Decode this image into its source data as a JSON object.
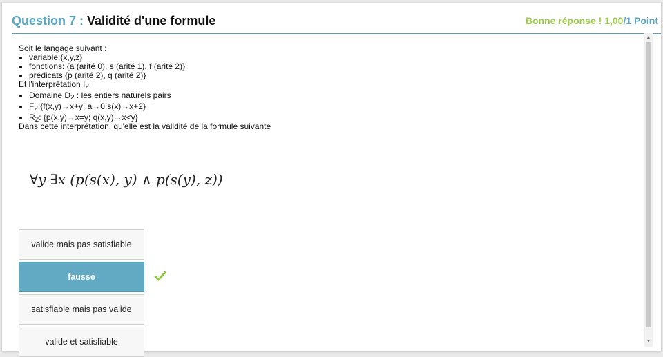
{
  "header": {
    "question_number": "Question 7 :",
    "question_title": "Validité d'une formule",
    "result_text": "Bonne réponse ! 1,00",
    "points_text": "/1 Point"
  },
  "body": {
    "intro": "Soit le langage suivant :",
    "language_items": [
      "variable:{x,y,z}",
      "fonctions: {a (arité 0), s (arité 1), f (arité 2)}",
      "prédicats {p (arité 2), q (arité 2)}"
    ],
    "interp_prefix": "Et l'interprétation I",
    "interp_sub": "2",
    "domain_prefix": "Domaine D",
    "domain_sub": "2",
    "domain_suffix": " : les entiers naturels pairs",
    "f_prefix": "F",
    "f_sub": "2",
    "f_suffix": ":{f(x,y)→x+y; a→0;s(x)→x+2}",
    "r_prefix": "R",
    "r_sub": "2",
    "r_suffix": ": {p(x,y)→x=y; q(x,y)→x<y}",
    "question": "Dans cette interprétation, qu'elle est la validité de la formule suivante"
  },
  "formula": "∀y ∃x (p(s(x), y) ∧ p(s(y), z))",
  "answers": [
    {
      "label": "valide mais pas satisfiable",
      "selected": false
    },
    {
      "label": "fausse",
      "selected": true
    },
    {
      "label": "satisfiable mais pas valide",
      "selected": false
    },
    {
      "label": "valide et satisfiable",
      "selected": false
    }
  ],
  "colors": {
    "accent": "#5aa6c3",
    "correct": "#9ccc4a",
    "selected_answer": "#62a9c3"
  },
  "icons": {
    "check": "check-icon"
  }
}
